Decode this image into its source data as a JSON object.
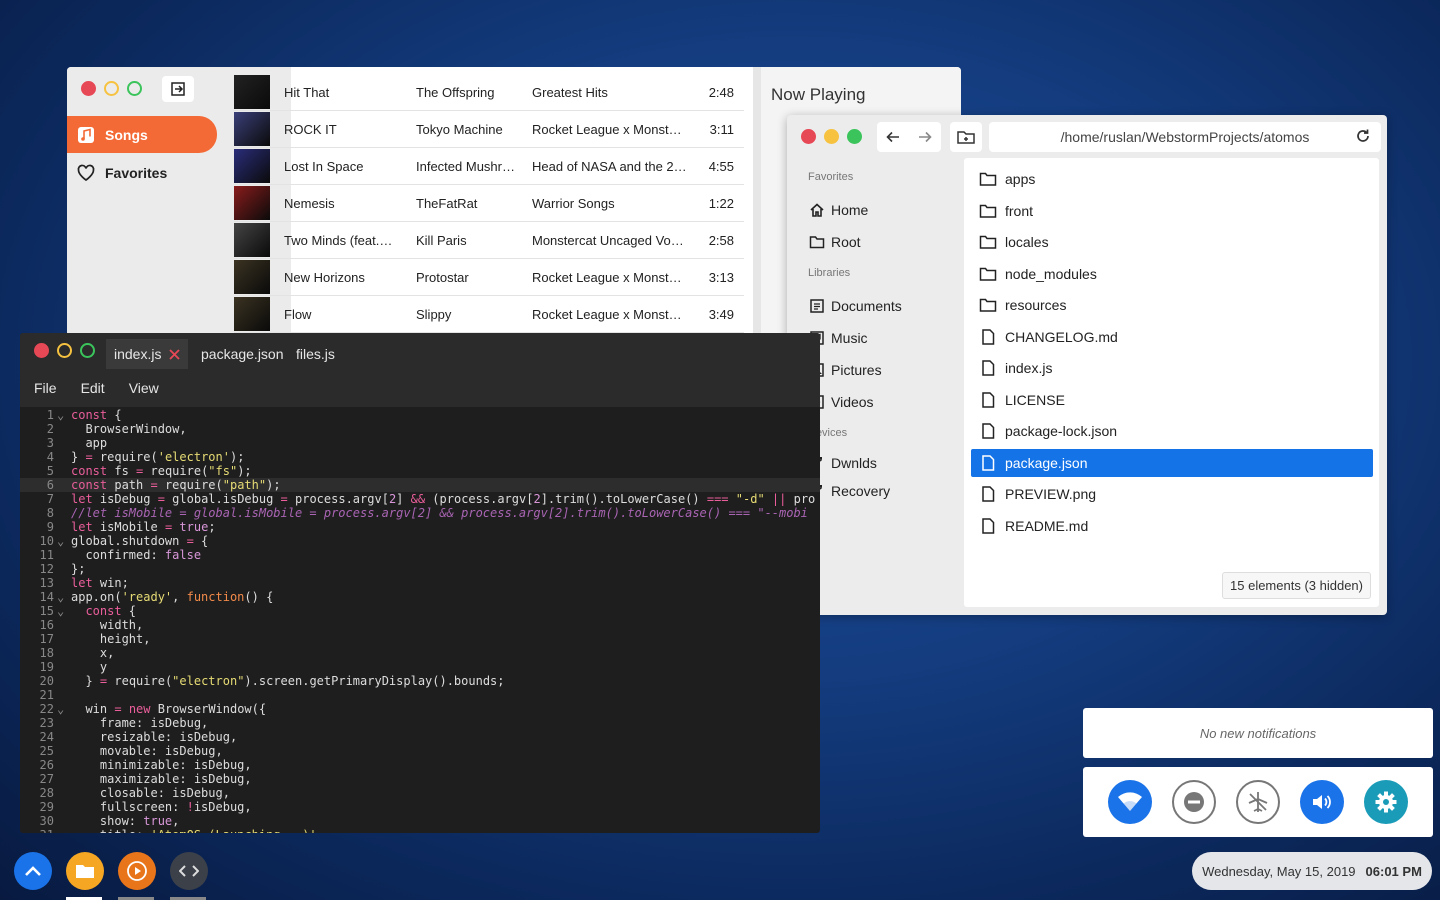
{
  "music": {
    "nav": [
      {
        "label": "Songs",
        "icon": "music-note-icon",
        "active": true
      },
      {
        "label": "Favorites",
        "icon": "heart-icon",
        "active": false
      }
    ],
    "songs": [
      {
        "title": "Hit That",
        "artist": "The Offspring",
        "album": "Greatest Hits",
        "duration": "2:48",
        "art_color": "#222"
      },
      {
        "title": "ROCK IT",
        "artist": "Tokyo Machine",
        "album": "Rocket League x Monst…",
        "duration": "3:11",
        "art_color": "#3a3f78"
      },
      {
        "title": "Lost In Space",
        "artist": "Infected Mushr…",
        "album": "Head of NASA and the 2…",
        "duration": "4:55",
        "art_color": "#2a2d7a"
      },
      {
        "title": "Nemesis",
        "artist": "TheFatRat",
        "album": "Warrior Songs",
        "duration": "1:22",
        "art_color": "#8a1c1c"
      },
      {
        "title": "Two Minds (feat.…",
        "artist": "Kill Paris",
        "album": "Monstercat Uncaged Vo…",
        "duration": "2:58",
        "art_color": "#444"
      },
      {
        "title": "New Horizons",
        "artist": "Protostar",
        "album": "Rocket League x Monst…",
        "duration": "3:13",
        "art_color": "#3b3322"
      },
      {
        "title": "Flow",
        "artist": "Slippy",
        "album": "Rocket League x Monst…",
        "duration": "3:49",
        "art_color": "#3b3322"
      }
    ],
    "now_playing": "Now Playing"
  },
  "files": {
    "path": "/home/ruslan/WebstormProjects/atomos",
    "sections": {
      "favorites": "Favorites",
      "libraries": "Libraries",
      "devices": "Devices"
    },
    "favorites": [
      {
        "label": "Home",
        "icon": "home-icon"
      },
      {
        "label": "Root",
        "icon": "folder-icon"
      }
    ],
    "libraries": [
      {
        "label": "Documents",
        "icon": "documents-icon"
      },
      {
        "label": "Music",
        "icon": "music-icon"
      },
      {
        "label": "Pictures",
        "icon": "pictures-icon"
      },
      {
        "label": "Videos",
        "icon": "videos-icon"
      }
    ],
    "devices": [
      {
        "label": "Dwnlds",
        "icon": "usb-icon"
      },
      {
        "label": "Recovery",
        "icon": "usb-icon"
      }
    ],
    "items": [
      {
        "name": "apps",
        "type": "folder"
      },
      {
        "name": "front",
        "type": "folder"
      },
      {
        "name": "locales",
        "type": "folder"
      },
      {
        "name": "node_modules",
        "type": "folder"
      },
      {
        "name": "resources",
        "type": "folder"
      },
      {
        "name": "CHANGELOG.md",
        "type": "file"
      },
      {
        "name": "index.js",
        "type": "file"
      },
      {
        "name": "LICENSE",
        "type": "file"
      },
      {
        "name": "package-lock.json",
        "type": "file"
      },
      {
        "name": "package.json",
        "type": "file",
        "selected": true
      },
      {
        "name": "PREVIEW.png",
        "type": "file"
      },
      {
        "name": "README.md",
        "type": "file"
      }
    ],
    "count": "15 elements (3 hidden)"
  },
  "editor": {
    "tabs": [
      "index.js",
      "package.json",
      "files.js"
    ],
    "menu": [
      "File",
      "Edit",
      "View"
    ],
    "current_line": 6,
    "lines": [
      "const {",
      "  BrowserWindow,",
      "  app",
      "} = require('electron');",
      "const fs = require(\"fs\");",
      "const path = require(\"path\");",
      "let isDebug = global.isDebug = process.argv[2] && (process.argv[2].trim().toLowerCase() === \"-d\" || pro",
      "//let isMobile = global.isMobile = process.argv[2] && process.argv[2].trim().toLowerCase() === \"--mobi",
      "let isMobile = true;",
      "global.shutdown = {",
      "  confirmed: false",
      "};",
      "let win;",
      "app.on('ready', function() {",
      "  const {",
      "    width,",
      "    height,",
      "    x,",
      "    y",
      "  } = require(\"electron\").screen.getPrimaryDisplay().bounds;",
      "",
      "  win = new BrowserWindow({",
      "    frame: isDebug,",
      "    resizable: isDebug,",
      "    movable: isDebug,",
      "    minimizable: isDebug,",
      "    maximizable: isDebug,",
      "    closable: isDebug,",
      "    fullscreen: !isDebug,",
      "    show: true,",
      "    title: 'AtomOS (Launching...)'"
    ],
    "fold_lines": [
      1,
      10,
      14,
      15,
      22
    ]
  },
  "notifications": {
    "empty_text": "No new notifications"
  },
  "quick_settings": [
    {
      "name": "wifi-toggle",
      "icon": "wifi-icon",
      "state": "on"
    },
    {
      "name": "dnd-toggle",
      "icon": "do-not-disturb-icon",
      "state": "off"
    },
    {
      "name": "airplane-toggle",
      "icon": "airplane-icon",
      "state": "off"
    },
    {
      "name": "sound-toggle",
      "icon": "volume-icon",
      "state": "on"
    },
    {
      "name": "settings-button",
      "icon": "gear-icon",
      "state": "teal"
    }
  ],
  "taskbar": {
    "apps": [
      {
        "name": "launcher-button",
        "icon": "chevron-up-icon",
        "color": "#1a73e8"
      },
      {
        "name": "files-app",
        "icon": "folder-icon",
        "color": "#f5a623"
      },
      {
        "name": "music-app",
        "icon": "play-circle-icon",
        "color": "#e8751a"
      },
      {
        "name": "code-app",
        "icon": "code-icon",
        "color": "#3c4049"
      }
    ],
    "date": "Wednesday, May 15, 2019",
    "time": "06:01 PM"
  },
  "colors": {
    "accent": "#f46a36",
    "selection": "#1473e6",
    "toggle_on": "#1a73e8"
  }
}
